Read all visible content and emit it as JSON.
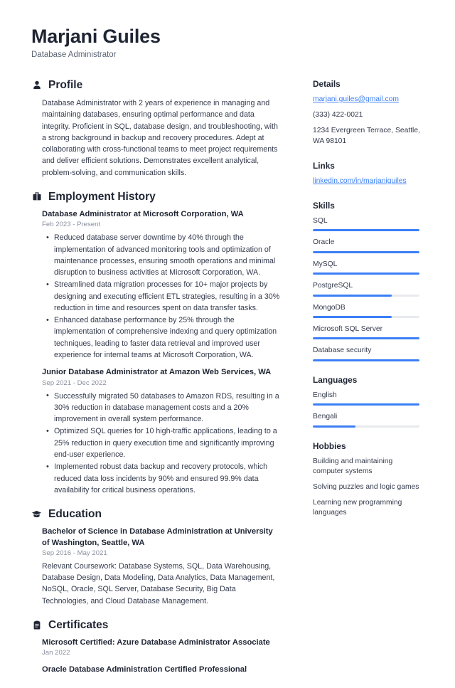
{
  "header": {
    "name": "Marjani Guiles",
    "title": "Database Administrator"
  },
  "accent_color": "#3b7ff5",
  "main": {
    "profile": {
      "heading": "Profile",
      "icon": "person-icon",
      "text": "Database Administrator with 2 years of experience in managing and maintaining databases, ensuring optimal performance and data integrity. Proficient in SQL, database design, and troubleshooting, with a strong background in backup and recovery procedures. Adept at collaborating with cross-functional teams to meet project requirements and deliver efficient solutions. Demonstrates excellent analytical, problem-solving, and communication skills."
    },
    "employment": {
      "heading": "Employment History",
      "icon": "briefcase-icon",
      "entries": [
        {
          "title": "Database Administrator at Microsoft Corporation, WA",
          "date": "Feb 2023 - Present",
          "bullets": [
            "Reduced database server downtime by 40% through the implementation of advanced monitoring tools and optimization of maintenance processes, ensuring smooth operations and minimal disruption to business activities at Microsoft Corporation, WA.",
            "Streamlined data migration processes for 10+ major projects by designing and executing efficient ETL strategies, resulting in a 30% reduction in time and resources spent on data transfer tasks.",
            "Enhanced database performance by 25% through the implementation of comprehensive indexing and query optimization techniques, leading to faster data retrieval and improved user experience for internal teams at Microsoft Corporation, WA."
          ]
        },
        {
          "title": "Junior Database Administrator at Amazon Web Services, WA",
          "date": "Sep 2021 - Dec 2022",
          "bullets": [
            "Successfully migrated 50 databases to Amazon RDS, resulting in a 30% reduction in database management costs and a 20% improvement in overall system performance.",
            "Optimized SQL queries for 10 high-traffic applications, leading to a 25% reduction in query execution time and significantly improving end-user experience.",
            "Implemented robust data backup and recovery protocols, which reduced data loss incidents by 90% and ensured 99.9% data availability for critical business operations."
          ]
        }
      ]
    },
    "education": {
      "heading": "Education",
      "icon": "graduation-cap-icon",
      "entries": [
        {
          "title": "Bachelor of Science in Database Administration at University of Washington, Seattle, WA",
          "date": "Sep 2016 - May 2021",
          "description": "Relevant Coursework: Database Systems, SQL, Data Warehousing, Database Design, Data Modeling, Data Analytics, Data Management, NoSQL, Oracle, SQL Server, Database Security, Big Data Technologies, and Cloud Database Management."
        }
      ]
    },
    "certificates": {
      "heading": "Certificates",
      "icon": "certificate-icon",
      "entries": [
        {
          "title": "Microsoft Certified: Azure Database Administrator Associate",
          "date": "Jan 2022"
        },
        {
          "title": "Oracle Database Administration Certified Professional",
          "date": ""
        }
      ]
    }
  },
  "sidebar": {
    "details": {
      "heading": "Details",
      "email": "marjani.guiles@gmail.com",
      "phone": "(333) 422-0021",
      "address": "1234 Evergreen Terrace, Seattle, WA 98101"
    },
    "links": {
      "heading": "Links",
      "items": [
        {
          "label": "linkedin.com/in/marjaniguiles"
        }
      ]
    },
    "skills": {
      "heading": "Skills",
      "items": [
        {
          "name": "SQL",
          "level": 100
        },
        {
          "name": "Oracle",
          "level": 100
        },
        {
          "name": "MySQL",
          "level": 100
        },
        {
          "name": "PostgreSQL",
          "level": 74
        },
        {
          "name": "MongoDB",
          "level": 74
        },
        {
          "name": "Microsoft SQL Server",
          "level": 100
        },
        {
          "name": "Database security",
          "level": 100
        }
      ]
    },
    "languages": {
      "heading": "Languages",
      "items": [
        {
          "name": "English",
          "level": 100
        },
        {
          "name": "Bengali",
          "level": 40
        }
      ]
    },
    "hobbies": {
      "heading": "Hobbies",
      "items": [
        {
          "text": "Building and maintaining computer systems"
        },
        {
          "text": "Solving puzzles and logic games"
        },
        {
          "text": "Learning new programming languages"
        }
      ]
    }
  }
}
